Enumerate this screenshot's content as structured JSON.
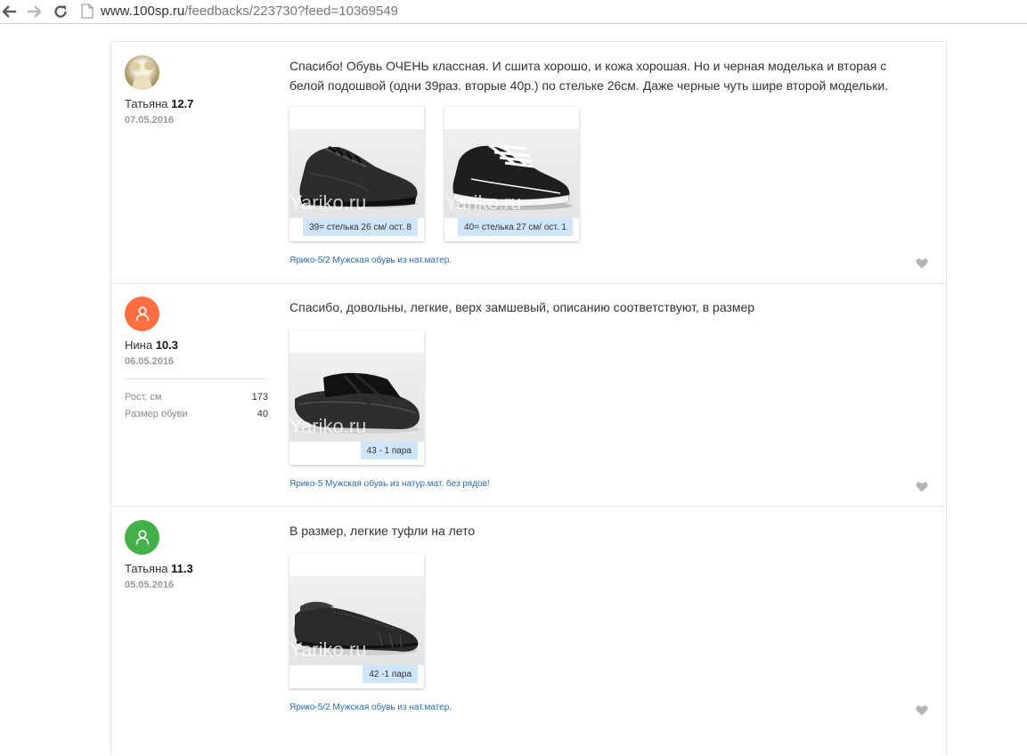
{
  "browser": {
    "url_host": "www.100sp.ru",
    "url_path": "/feedbacks/223730?feed=10369549",
    "icons": [
      "back-arrow-icon",
      "forward-arrow-icon",
      "reload-icon",
      "page-icon"
    ]
  },
  "colors": {
    "accent_link": "#2a6bb3",
    "caption_bg": "#cfe5fb",
    "avatar_orange": "#ff6f42",
    "avatar_green": "#43b049"
  },
  "reviews": [
    {
      "user": "Татьяна",
      "rating": "12.7",
      "date": "07.05.2016",
      "avatar": "photo",
      "text": "Спасибо! Обувь ОЧЕНЬ классная. И сшита хорошо, и кожа хорошая. Но и черная моделька и вторая с белой подошвой (одни 39раз. вторые 40р.) по стельке 26см. Даже черные чуть шире второй модельки.",
      "photos": [
        {
          "caption": "39= стелька 26 см/ ост. 8",
          "watermark": "Yariko.ru",
          "image": "black-sneaker"
        },
        {
          "caption": "40= стелька 27 см/ ост. 1",
          "watermark": "Yariko.ru",
          "image": "black-sneaker-white-laces"
        }
      ],
      "product_link": "Ярико-5/2 Мужская обувь из нат.матер."
    },
    {
      "user": "Нина",
      "rating": "10.3",
      "date": "06.05.2016",
      "avatar": "user-icon",
      "stats": [
        {
          "label": "Рост, см",
          "value": "173"
        },
        {
          "label": "Размер обуви",
          "value": "40"
        }
      ],
      "text": "Спасибо, довольны, легкие, верх замшевый, описанию соответствуют, в размер",
      "photos": [
        {
          "caption": "43 - 1 пара",
          "watermark": "Yariko.ru",
          "image": "black-sandal"
        }
      ],
      "product_link": "Ярико-5 Мужская обувь из натур.мат. без рядов!"
    },
    {
      "user": "Татьяна",
      "rating": "11.3",
      "date": "05.05.2016",
      "avatar": "user-icon",
      "text": "В размер, легкие туфли на лето",
      "photos": [
        {
          "caption": "42 -1 пара",
          "watermark": "Yariko.ru",
          "image": "black-moccasin"
        }
      ],
      "product_link": "Ярико-5/2 Мужская обувь из нат.матер."
    }
  ]
}
